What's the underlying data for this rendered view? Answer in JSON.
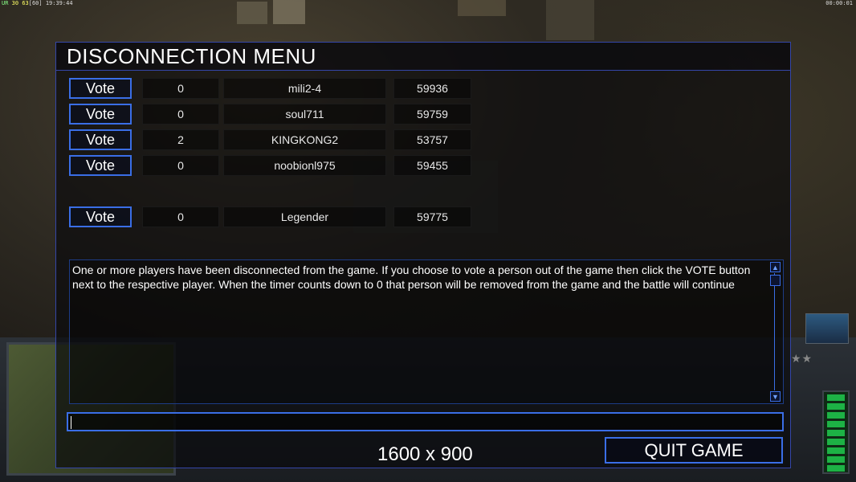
{
  "hud": {
    "top_left_prefix": "UR",
    "fps": "30",
    "fps_avg": "63",
    "fps_max": "[60]",
    "clock": "19:39:44",
    "top_right_timer": "00:00:01"
  },
  "dialog": {
    "title": "DISCONNECTION MENU",
    "vote_label": "Vote",
    "players": [
      {
        "votes": "0",
        "name": "mili2-4",
        "timer": "59936"
      },
      {
        "votes": "0",
        "name": "soul711",
        "timer": "59759"
      },
      {
        "votes": "2",
        "name": "KINGKONG2",
        "timer": "53757"
      },
      {
        "votes": "0",
        "name": "noobionl975",
        "timer": "59455"
      },
      {
        "votes": "0",
        "name": "Legender",
        "timer": "59775"
      }
    ],
    "message": "One or more players have been disconnected from the game. If you choose to vote a person out of the game then click the VOTE button next to the respective player. When the timer counts down to 0 that person will be removed from the game and the battle will continue",
    "chat_value": "",
    "quit_label": "QUIT GAME"
  },
  "overlay": {
    "resolution_text": "1600 x 900"
  },
  "colors": {
    "accent": "#3a6ee6",
    "frame": "#3446a8"
  },
  "icons": [
    "scroll-up-icon",
    "scroll-down-icon",
    "power-meter-icon"
  ]
}
